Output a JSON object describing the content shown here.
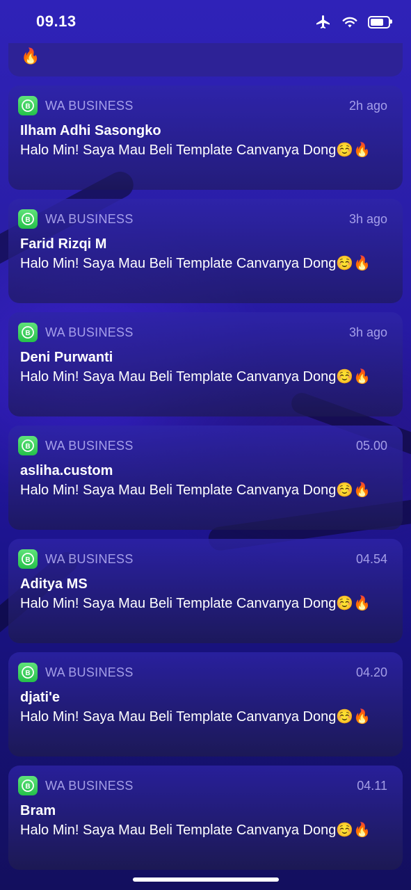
{
  "status_bar": {
    "time": "09.13",
    "icons": [
      "airplane-icon",
      "wifi-icon",
      "battery-icon"
    ]
  },
  "partial_notification": {
    "emoji": "🔥"
  },
  "notifications": [
    {
      "app": "WA BUSINESS",
      "time": "2h ago",
      "sender": "Ilham Adhi Sasongko",
      "message": "Halo Min! Saya Mau Beli Template Canvanya Dong☺️🔥"
    },
    {
      "app": "WA BUSINESS",
      "time": "3h ago",
      "sender": "Farid Rizqi M",
      "message": "Halo Min! Saya Mau Beli Template Canvanya Dong☺️🔥"
    },
    {
      "app": "WA BUSINESS",
      "time": "3h ago",
      "sender": "Deni Purwanti",
      "message": "Halo Min! Saya Mau Beli Template Canvanya Dong☺️🔥"
    },
    {
      "app": "WA BUSINESS",
      "time": "05.00",
      "sender": "asliha.custom",
      "message": "Halo Min! Saya Mau Beli Template Canvanya Dong☺️🔥"
    },
    {
      "app": "WA BUSINESS",
      "time": "04.54",
      "sender": "Aditya MS",
      "message": "Halo Min! Saya Mau Beli Template Canvanya Dong☺️🔥"
    },
    {
      "app": "WA BUSINESS",
      "time": "04.20",
      "sender": "djati'e",
      "message": "Halo Min! Saya Mau Beli Template Canvanya Dong☺️🔥"
    },
    {
      "app": "WA BUSINESS",
      "time": "04.11",
      "sender": "Bram",
      "message": "Halo Min! Saya Mau Beli Template Canvanya Dong☺️🔥"
    }
  ],
  "colors": {
    "card_background_top": "#2e24a8",
    "card_background_bottom": "#1d1a52",
    "app_icon_green": "#25c04a"
  }
}
